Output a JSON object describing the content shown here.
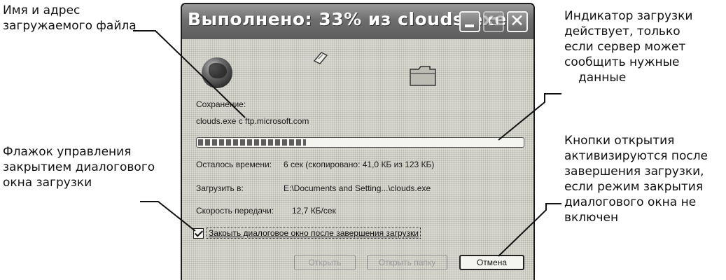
{
  "dialog": {
    "title": "Выполнено: 33% из clouds.exe",
    "saving_label": "Сохранение:",
    "file_source": "clouds.exe с ftp.microsoft.com",
    "progress": 0.33,
    "time_left_label": "Осталось времени:",
    "time_left_value": "6 сек (скопировано: 41,0 КБ из 123 КБ)",
    "download_to_label": "Загрузить в:",
    "download_to_value": "E:\\Documents and Setting...\\clouds.exe",
    "speed_label": "Скорость передачи:",
    "speed_value": "12,7 КБ/сек",
    "close_checkbox_label": "Закрыть диалоговое окно после завершения загрузки",
    "close_checkbox_checked": true,
    "open_button": "Открыть",
    "open_folder_button": "Открыть папку",
    "cancel_button": "Отмена",
    "icons": {
      "minimize": "minimize-icon",
      "maximize": "maximize-icon",
      "close": "close-icon",
      "globe": "globe-icon",
      "paper": "flying-document-icon",
      "folder": "folder-icon"
    }
  },
  "callouts": {
    "file_name": [
      "Имя и адрес",
      "загружаемого файла"
    ],
    "progress": [
      "Индикатор загрузки",
      "действует, только",
      "если сервер может",
      "сообщить нужные",
      "данные"
    ],
    "checkbox": [
      "Флажок управления",
      "закрытием диалогового",
      "окна загрузки"
    ],
    "buttons": [
      "Кнопки открытия",
      "активизируются после",
      "завершения загрузки,",
      "если режим закрытия",
      "диалогового окна не",
      "включен"
    ]
  }
}
